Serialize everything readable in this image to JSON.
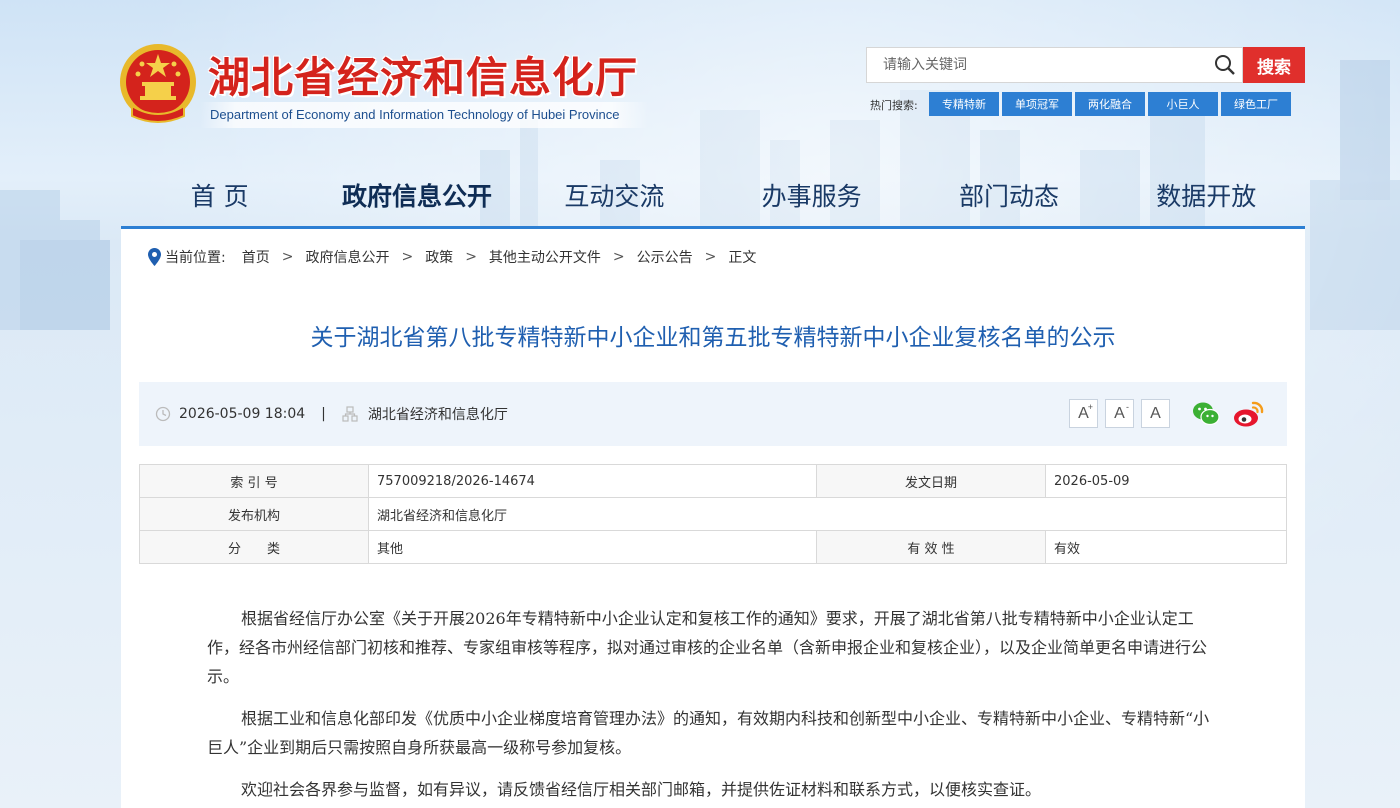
{
  "header": {
    "site_title": "湖北省经济和信息化厅",
    "site_subtitle": "Department of Economy and Information Technology of Hubei Province",
    "search_placeholder": "请输入关键词",
    "search_button": "搜索",
    "hot_label": "热门搜索:",
    "hot_tags": [
      "专精特新",
      "单项冠军",
      "两化融合",
      "小巨人",
      "绿色工厂"
    ]
  },
  "nav": {
    "items": [
      "首 页",
      "政府信息公开",
      "互动交流",
      "办事服务",
      "部门动态",
      "数据开放"
    ],
    "active": "政府信息公开"
  },
  "breadcrumb": {
    "label": "当前位置:",
    "items": [
      "首页",
      "政府信息公开",
      "政策",
      "其他主动公开文件",
      "公示公告",
      "正文"
    ],
    "separator": ">"
  },
  "article": {
    "title": "关于湖北省第八批专精特新中小企业和第五批专精特新中小企业复核名单的公示",
    "datetime": "2026-05-09 18:04",
    "divider": "|",
    "source": "湖北省经济和信息化厅",
    "font_sizes": [
      "A",
      "A",
      "A"
    ],
    "font_plus": "+",
    "font_minus": "-"
  },
  "info_table": {
    "index_label": "索 引 号",
    "index_value": "757009218/2026-14674",
    "date_label": "发文日期",
    "date_value": "2026-05-09",
    "publisher_label": "发布机构",
    "publisher_value": "湖北省经济和信息化厅",
    "category_label": "分　　类",
    "category_value": "其他",
    "validity_label": "有 效 性",
    "validity_value": "有效"
  },
  "body": {
    "paragraphs": [
      "根据省经信厅办公室《关于开展2026年专精特新中小企业认定和复核工作的通知》要求，开展了湖北省第八批专精特新中小企业认定工作，经各市州经信部门初核和推荐、专家组审核等程序，拟对通过审核的企业名单（含新申报企业和复核企业），以及企业简单更名申请进行公示。",
      "根据工业和信息化部印发《优质中小企业梯度培育管理办法》的通知，有效期内科技和创新型中小企业、专精特新中小企业、专精特新“小巨人”企业到期后只需按照自身所获最高一级称号参加复核。",
      "欢迎社会各界参与监督，如有异议，请反馈省经信厅相关部门邮箱，并提供佐证材料和联系方式，以便核实查证。"
    ]
  },
  "colors": {
    "title_red": "#d4231c",
    "accent_blue": "#2d7fd3",
    "article_title_blue": "#1f5fb0",
    "search_red": "#e02f2c"
  }
}
